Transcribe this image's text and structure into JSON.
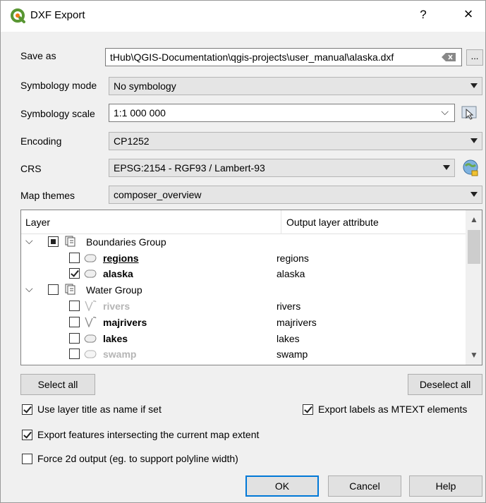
{
  "window": {
    "title": "DXF Export",
    "help": "?",
    "close": "×"
  },
  "form": {
    "save_as": {
      "label": "Save as",
      "value": "tHub\\QGIS-Documentation\\qgis-projects\\user_manual\\alaska.dxf",
      "browse": "..."
    },
    "symbology_mode": {
      "label": "Symbology mode",
      "value": "No symbology"
    },
    "symbology_scale": {
      "label": "Symbology scale",
      "value": "1:1 000 000"
    },
    "encoding": {
      "label": "Encoding",
      "value": "CP1252"
    },
    "crs": {
      "label": "CRS",
      "value": "EPSG:2154 - RGF93 / Lambert-93"
    },
    "map_themes": {
      "label": "Map themes",
      "value": "composer_overview"
    }
  },
  "tree": {
    "headers": {
      "layer": "Layer",
      "attribute": "Output layer attribute"
    },
    "rows": [
      {
        "name": "Boundaries Group",
        "attr": "",
        "state": "partial",
        "type": "group"
      },
      {
        "name": "regions",
        "attr": "regions",
        "state": "unchecked",
        "type": "polygon"
      },
      {
        "name": "alaska",
        "attr": "alaska",
        "state": "checked",
        "type": "polygon"
      },
      {
        "name": "Water Group",
        "attr": "",
        "state": "unchecked",
        "type": "group"
      },
      {
        "name": "rivers",
        "attr": "rivers",
        "state": "unchecked",
        "type": "line"
      },
      {
        "name": "majrivers",
        "attr": "majrivers",
        "state": "unchecked",
        "type": "line"
      },
      {
        "name": "lakes",
        "attr": "lakes",
        "state": "unchecked",
        "type": "polygon"
      },
      {
        "name": "swamp",
        "attr": "swamp",
        "state": "unchecked",
        "type": "polygon"
      }
    ]
  },
  "buttons": {
    "select_all": "Select all",
    "deselect_all": "Deselect all",
    "ok": "OK",
    "cancel": "Cancel",
    "help": "Help"
  },
  "options": {
    "use_layer_title": {
      "label": "Use layer title as name if set",
      "checked": true
    },
    "export_labels": {
      "label": "Export labels as MTEXT elements",
      "checked": true
    },
    "intersecting": {
      "label": "Export features intersecting the current map extent",
      "checked": true
    },
    "force_2d": {
      "label": "Force 2d output (eg. to support polyline width)",
      "checked": false
    }
  },
  "colors": {
    "accent": "#0078d7",
    "qgis_green": "#589632"
  }
}
